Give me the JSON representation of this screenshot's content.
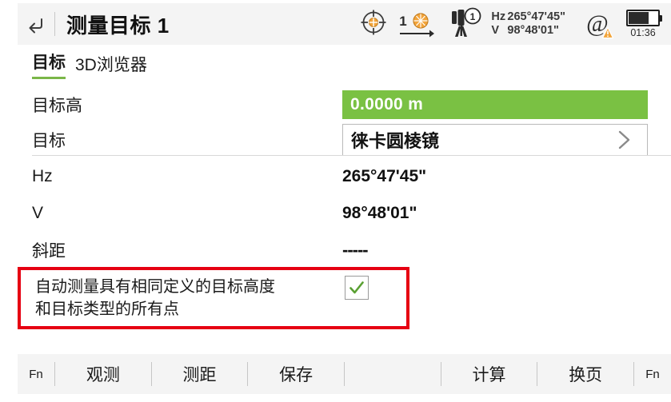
{
  "header": {
    "back_icon": "back-arrow-icon",
    "title": "测量目标 1",
    "status": {
      "target_icon": "crosshair-target-icon",
      "prism_number_icon": "prism-number-1-icon",
      "prism_number": "1",
      "tripod_icon": "tripod-face-1-icon",
      "tripod_face": "1",
      "hz_label": "Hz",
      "hz_value": "265°47'45\"",
      "v_label": "V",
      "v_value": "98°48'01\"",
      "at_icon": "at-symbol-warning-icon",
      "battery_icon": "battery-icon",
      "battery_time": "01:36"
    }
  },
  "tabs": [
    {
      "label": "目标",
      "active": true
    },
    {
      "label": "3D浏览器",
      "active": false
    }
  ],
  "form": {
    "rows": [
      {
        "label": "目标高",
        "value": "0.0000 m",
        "style": "green-field"
      },
      {
        "label": "目标",
        "value": "徕卡圆棱镜",
        "style": "boxed-field",
        "chevron": "chevron-right-icon"
      },
      {
        "label": "Hz",
        "value": "265°47'45\"",
        "style": "plain"
      },
      {
        "label": "V",
        "value": "98°48'01\"",
        "style": "plain"
      },
      {
        "label": "斜距",
        "value": "-----",
        "style": "plain-dashes"
      }
    ]
  },
  "checkbox_block": {
    "text_line1": "自动测量具有相同定义的目标高度",
    "text_line2": "和目标类型的所有点",
    "checked": true,
    "check_icon": "checkmark-icon",
    "highlight_color": "#e60012"
  },
  "bottom_bar": {
    "keys": [
      {
        "label": "Fn",
        "type": "fn"
      },
      {
        "label": "观测",
        "type": "main"
      },
      {
        "label": "测距",
        "type": "main"
      },
      {
        "label": "保存",
        "type": "main"
      },
      {
        "label": "",
        "type": "empty"
      },
      {
        "label": "计算",
        "type": "main"
      },
      {
        "label": "换页",
        "type": "main"
      },
      {
        "label": "Fn",
        "type": "fn"
      }
    ]
  },
  "colors": {
    "accent_green": "#7ac143",
    "tab_underline": "#7ab648",
    "highlight_red": "#e60012",
    "bar_background": "#f4f4f4"
  }
}
